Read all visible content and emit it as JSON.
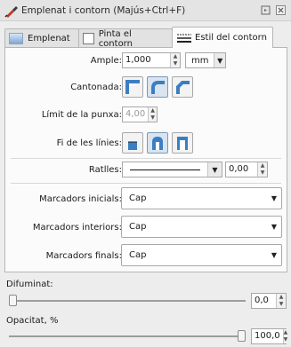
{
  "window": {
    "title": "Emplenat i contorn (Majús+Ctrl+F)",
    "icons": {
      "app": "fill-stroke-icon",
      "restore": "restore-icon",
      "close": "close-icon"
    }
  },
  "tabs": [
    {
      "label": "Emplenat",
      "icon": "fill-swatch-icon"
    },
    {
      "label": "Pinta el contorn",
      "icon": "stroke-paint-icon"
    },
    {
      "label": "Estil del contorn",
      "icon": "stroke-style-icon",
      "active": true
    }
  ],
  "stroke_style": {
    "width": {
      "label": "Ample:",
      "value": "1,000",
      "unit": "mm"
    },
    "join": {
      "label": "Cantonada:",
      "options": [
        "miter-join-icon",
        "round-join-icon",
        "bevel-join-icon"
      ],
      "selected": 1
    },
    "miter_limit": {
      "label": "Límit de la punxa:",
      "value": "4,00"
    },
    "cap": {
      "label": "Fi de les línies:",
      "options": [
        "butt-cap-icon",
        "round-cap-icon",
        "square-cap-icon"
      ],
      "selected": 1
    },
    "dashes": {
      "label": "Ratlles:",
      "offset": "0,00"
    },
    "markers_start": {
      "label": "Marcadors inicials:",
      "value": "Cap"
    },
    "markers_mid": {
      "label": "Marcadors interiors:",
      "value": "Cap"
    },
    "markers_end": {
      "label": "Marcadors finals:",
      "value": "Cap"
    }
  },
  "blur": {
    "label": "Difuminat:",
    "value": "0,0",
    "level": 0
  },
  "opacity": {
    "label": "Opacitat, %",
    "value": "100,0",
    "level": 100
  }
}
